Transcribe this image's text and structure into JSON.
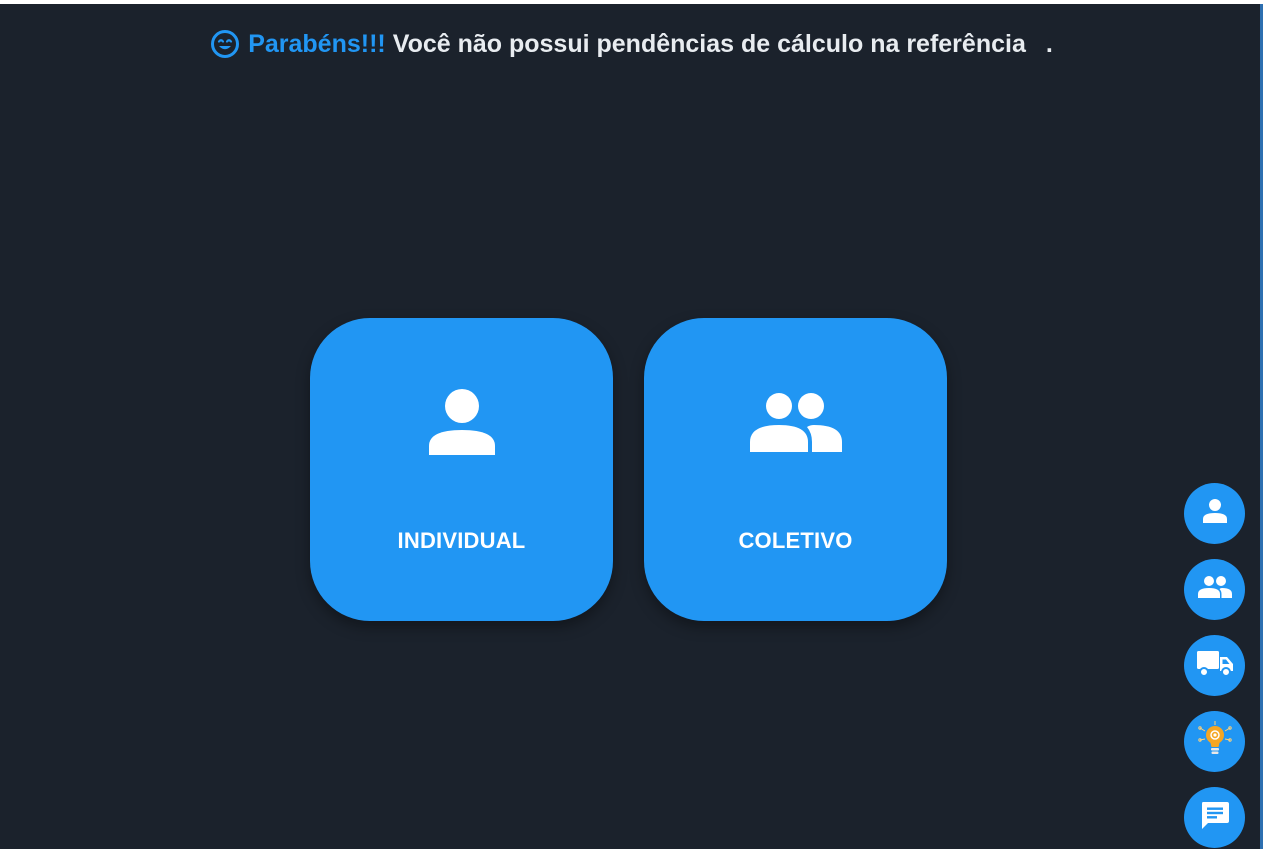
{
  "banner": {
    "icon": "smile-icon",
    "congrats": "Parabéns!!!",
    "message": "Você não possui pendências de cálculo na referência",
    "trailing": "."
  },
  "cards": [
    {
      "label": "INDIVIDUAL",
      "icon": "person-icon"
    },
    {
      "label": "COLETIVO",
      "icon": "group-icon"
    }
  ],
  "fabs": [
    {
      "icon": "person-icon"
    },
    {
      "icon": "group-icon"
    },
    {
      "icon": "truck-icon"
    },
    {
      "icon": "lightbulb-icon"
    },
    {
      "icon": "chat-icon"
    }
  ],
  "colors": {
    "background": "#1b222c",
    "accent": "#2196f3",
    "text": "#e8ecf0",
    "bulb": "#f5a623"
  }
}
